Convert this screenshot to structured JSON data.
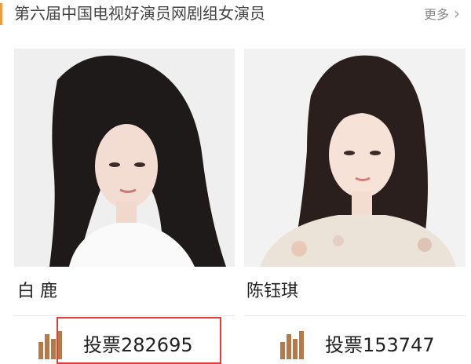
{
  "header": {
    "title": "第六届中国电视好演员网剧组女演员",
    "more_label": "更多",
    "more_icon": "chevron-right-icon",
    "accent_color": "#f29b3a"
  },
  "candidates": [
    {
      "name": "白  鹿",
      "vote_label": "投票282695",
      "vote_count": 282695,
      "vote_icon": "bar-chart-icon"
    },
    {
      "name": "陈钰琪",
      "vote_label": "投票153747",
      "vote_count": 153747,
      "vote_icon": "bar-chart-icon"
    }
  ],
  "colors": {
    "vote_icon": "#b47a4a",
    "highlight_border": "#e23b3b"
  }
}
